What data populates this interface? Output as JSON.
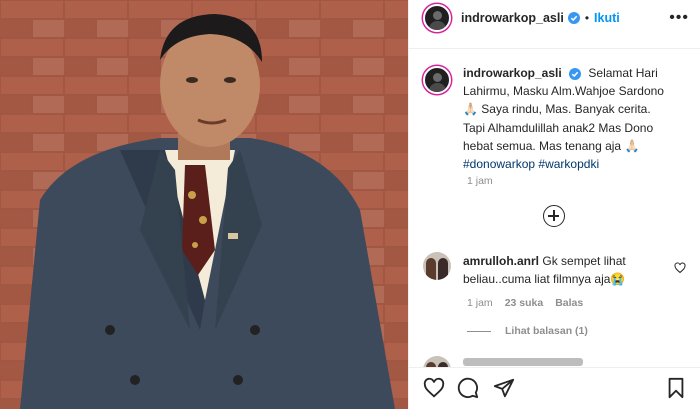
{
  "post": {
    "username": "indrowarkop_asli",
    "follow_label": "Ikuti",
    "dot": "•",
    "more": "•••",
    "caption_lines": [
      "Selamat Hari",
      "Lahirmu, Masku Alm.Wahjoe Sardono",
      "🙏🏻 Saya rindu, Mas. Banyak cerita.",
      "Tapi Alhamdulillah anak2 Mas Dono",
      "hebat semua. Mas tenang aja 🙏🏻"
    ],
    "hashtags": [
      "#donowarkop",
      "#warkopdki"
    ],
    "time": "1 jam"
  },
  "comment": {
    "username": "amrulloh.anrl",
    "text": "Gk sempet lihat beliau..cuma liat filmnya aja😭",
    "time": "1 jam",
    "likes": "23 suka",
    "reply": "Balas",
    "view_replies": "Lihat balasan (1)"
  },
  "colors": {
    "accent": "#0095f6",
    "hashtag": "#00376b",
    "muted": "#8e8e8e",
    "story_ring": "#d6249f"
  },
  "icons": [
    "verified-icon",
    "more-icon",
    "add-comment-icon",
    "heart-icon",
    "comment-icon",
    "share-icon",
    "bookmark-icon"
  ]
}
